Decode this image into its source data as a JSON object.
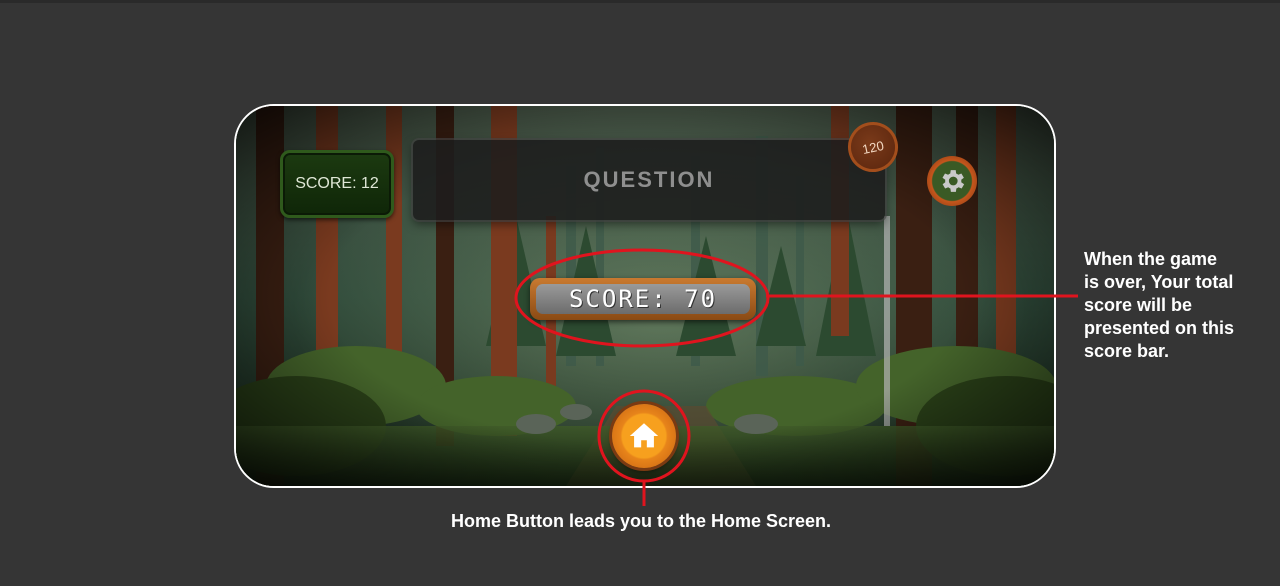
{
  "game": {
    "score_label": "SCORE: 12",
    "question_label": "QUESTION",
    "timer_value": "120",
    "final_score_label": "SCORE: 70"
  },
  "icons": {
    "settings": "gear-icon",
    "home": "home-icon"
  },
  "annotations": {
    "score_bar_note_lines": [
      "When the game",
      "is over, Your total",
      "score will be",
      "presented on this",
      "score bar."
    ],
    "home_button_note": "Home Button leads you to the Home Screen."
  },
  "colors": {
    "background": "#353535",
    "callout_red": "#e0141e",
    "accent_orange": "#f7a01e",
    "score_green": "#1c3a10"
  }
}
